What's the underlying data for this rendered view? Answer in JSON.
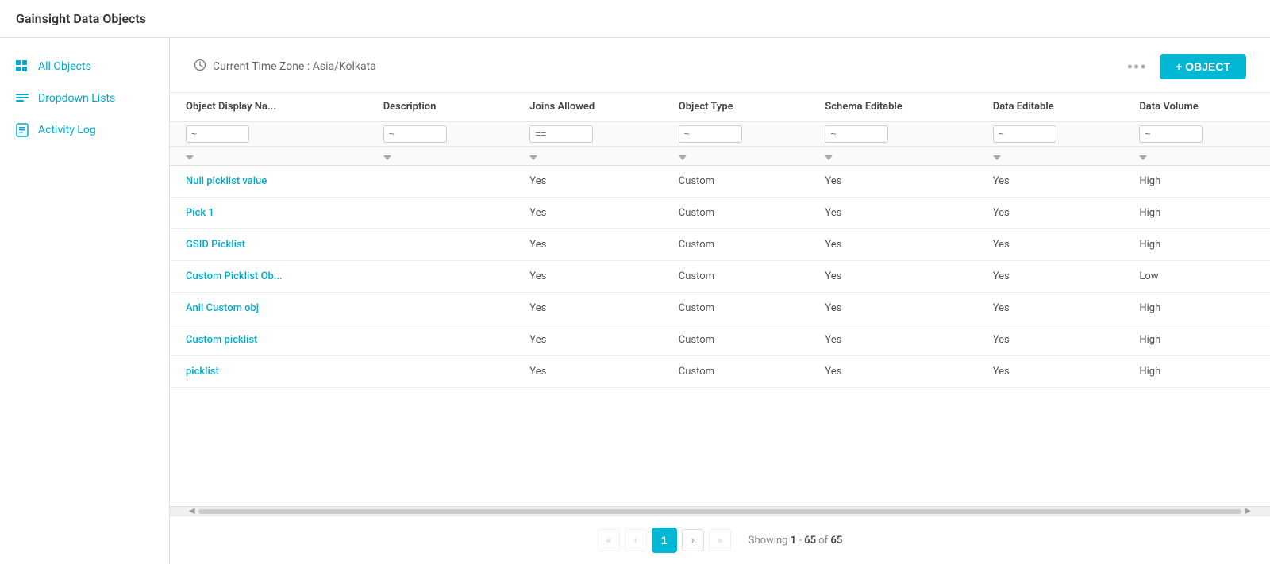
{
  "app": {
    "title": "Gainsight Data Objects"
  },
  "sidebar": {
    "items": [
      {
        "id": "all-objects",
        "label": "All Objects",
        "active": true,
        "icon": "grid-icon"
      },
      {
        "id": "dropdown-lists",
        "label": "Dropdown Lists",
        "active": false,
        "icon": "list-icon"
      },
      {
        "id": "activity-log",
        "label": "Activity Log",
        "active": false,
        "icon": "log-icon"
      }
    ]
  },
  "toolbar": {
    "timezone_label": "Current Time Zone : Asia/Kolkata",
    "more_label": "•••",
    "add_object_label": "+ OBJECT"
  },
  "table": {
    "columns": [
      {
        "id": "name",
        "label": "Object Display Na..."
      },
      {
        "id": "description",
        "label": "Description"
      },
      {
        "id": "joins_allowed",
        "label": "Joins Allowed"
      },
      {
        "id": "object_type",
        "label": "Object Type"
      },
      {
        "id": "schema_editable",
        "label": "Schema Editable"
      },
      {
        "id": "data_editable",
        "label": "Data Editable"
      },
      {
        "id": "data_volume",
        "label": "Data Volume"
      }
    ],
    "filter_row": {
      "name_filter": "~",
      "description_filter": "~",
      "joins_filter": "==",
      "object_type_filter": "~",
      "schema_filter": "~",
      "data_editable_filter": "~",
      "data_volume_filter": "~"
    },
    "rows": [
      {
        "name": "Null picklist value",
        "description": "",
        "joins_allowed": "Yes",
        "object_type": "Custom",
        "schema_editable": "Yes",
        "data_editable": "Yes",
        "data_volume": "High"
      },
      {
        "name": "Pick 1",
        "description": "",
        "joins_allowed": "Yes",
        "object_type": "Custom",
        "schema_editable": "Yes",
        "data_editable": "Yes",
        "data_volume": "High"
      },
      {
        "name": "GSID Picklist",
        "description": "",
        "joins_allowed": "Yes",
        "object_type": "Custom",
        "schema_editable": "Yes",
        "data_editable": "Yes",
        "data_volume": "High"
      },
      {
        "name": "Custom Picklist Ob...",
        "description": "",
        "joins_allowed": "Yes",
        "object_type": "Custom",
        "schema_editable": "Yes",
        "data_editable": "Yes",
        "data_volume": "Low"
      },
      {
        "name": "Anil Custom obj",
        "description": "",
        "joins_allowed": "Yes",
        "object_type": "Custom",
        "schema_editable": "Yes",
        "data_editable": "Yes",
        "data_volume": "High"
      },
      {
        "name": "Custom picklist",
        "description": "",
        "joins_allowed": "Yes",
        "object_type": "Custom",
        "schema_editable": "Yes",
        "data_editable": "Yes",
        "data_volume": "High"
      },
      {
        "name": "picklist",
        "description": "",
        "joins_allowed": "Yes",
        "object_type": "Custom",
        "schema_editable": "Yes",
        "data_editable": "Yes",
        "data_volume": "High"
      }
    ]
  },
  "pagination": {
    "current_page": 1,
    "showing_text": "Showing",
    "range_start": "1",
    "range_separator": "-",
    "range_end": "65",
    "of_label": "of",
    "total": "65"
  },
  "colors": {
    "primary": "#00b8d4",
    "link": "#00aacc",
    "text_dark": "#333",
    "text_mid": "#555",
    "text_light": "#888"
  }
}
